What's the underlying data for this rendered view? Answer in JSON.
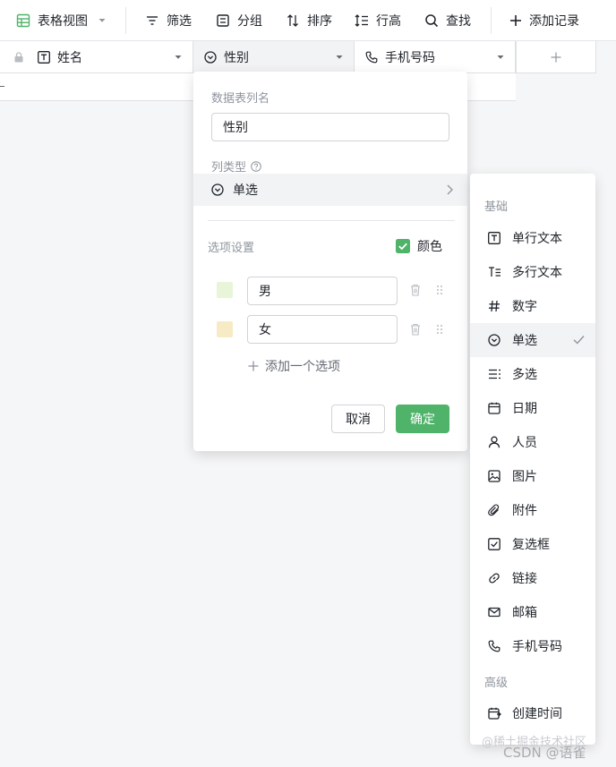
{
  "toolbar": {
    "view_label": "表格视图",
    "filter_label": "筛选",
    "group_label": "分组",
    "sort_label": "排序",
    "row_height_label": "行高",
    "search_label": "查找",
    "add_record_label": "添加记录"
  },
  "columns": [
    {
      "name": "姓名",
      "icon": "text-icon"
    },
    {
      "name": "性别",
      "icon": "single-select-icon"
    },
    {
      "name": "手机号码",
      "icon": "phone-icon"
    }
  ],
  "popup": {
    "column_name_label": "数据表列名",
    "column_name_value": "性别",
    "column_type_label": "列类型",
    "column_type_value": "单选",
    "options_label": "选项设置",
    "color_label": "颜色",
    "color_checked": true,
    "options": [
      {
        "value": "男",
        "color": "#e8f5d9"
      },
      {
        "value": "女",
        "color": "#f7ebc6"
      }
    ],
    "add_option_label": "添加一个选项",
    "cancel_label": "取消",
    "confirm_label": "确定",
    "accent_color": "#4fb369"
  },
  "type_menu": {
    "basic_group": "基础",
    "advanced_group": "高级",
    "items": [
      {
        "label": "单行文本",
        "icon": "text-icon"
      },
      {
        "label": "多行文本",
        "icon": "multiline-text-icon"
      },
      {
        "label": "数字",
        "icon": "hash-icon"
      },
      {
        "label": "单选",
        "icon": "single-select-icon",
        "selected": true
      },
      {
        "label": "多选",
        "icon": "multi-select-icon"
      },
      {
        "label": "日期",
        "icon": "calendar-icon"
      },
      {
        "label": "人员",
        "icon": "person-icon"
      },
      {
        "label": "图片",
        "icon": "image-icon"
      },
      {
        "label": "附件",
        "icon": "paperclip-icon"
      },
      {
        "label": "复选框",
        "icon": "checkbox-icon"
      },
      {
        "label": "链接",
        "icon": "link-icon"
      },
      {
        "label": "邮箱",
        "icon": "mail-icon"
      },
      {
        "label": "手机号码",
        "icon": "phone-icon"
      }
    ],
    "advanced_items": [
      {
        "label": "创建时间",
        "icon": "calendar-clock-icon"
      }
    ]
  },
  "watermark": {
    "line1": "@稀土掘金技术社区",
    "line2": "CSDN @语雀"
  }
}
